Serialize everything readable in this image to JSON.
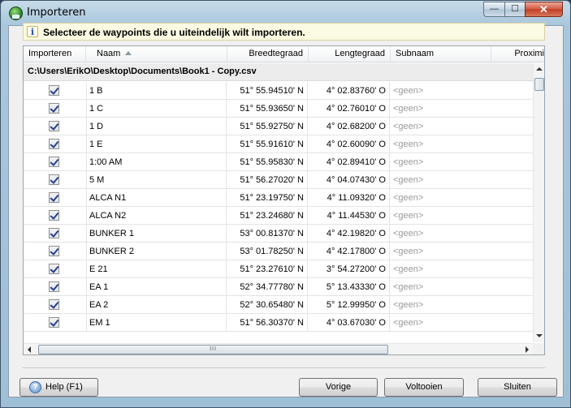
{
  "window": {
    "title": "Importeren",
    "min_glyph": "—",
    "max_glyph": "☐",
    "close_glyph": "✕"
  },
  "info": {
    "icon": "i",
    "text": "Selecteer de waypoints die u uiteindelijk wilt importeren."
  },
  "table": {
    "columns": [
      "Importeren",
      "Naam",
      "Breedtegraad",
      "Lengtegraad",
      "Subnaam",
      "Proximi"
    ],
    "sort_column": "Naam",
    "group_label": "C:\\Users\\ErikO\\Desktop\\Documents\\Book1 - Copy.csv",
    "rows": [
      {
        "checked": true,
        "name": "1 B",
        "lat": "51° 55.94510' N",
        "lon": "4° 02.83760' O",
        "sub": "<geen>"
      },
      {
        "checked": true,
        "name": "1 C",
        "lat": "51° 55.93650' N",
        "lon": "4° 02.76010' O",
        "sub": "<geen>"
      },
      {
        "checked": true,
        "name": "1 D",
        "lat": "51° 55.92750' N",
        "lon": "4° 02.68200' O",
        "sub": "<geen>"
      },
      {
        "checked": true,
        "name": "1 E",
        "lat": "51° 55.91610' N",
        "lon": "4° 02.60090' O",
        "sub": "<geen>"
      },
      {
        "checked": true,
        "name": "1:00 AM",
        "lat": "51° 55.95830' N",
        "lon": "4° 02.89410' O",
        "sub": "<geen>"
      },
      {
        "checked": true,
        "name": "5 M",
        "lat": "51° 56.27020' N",
        "lon": "4° 04.07430' O",
        "sub": "<geen>"
      },
      {
        "checked": true,
        "name": "ALCA N1",
        "lat": "51° 23.19750' N",
        "lon": "4° 11.09320' O",
        "sub": "<geen>"
      },
      {
        "checked": true,
        "name": "ALCA N2",
        "lat": "51° 23.24680' N",
        "lon": "4° 11.44530' O",
        "sub": "<geen>"
      },
      {
        "checked": true,
        "name": "BUNKER 1",
        "lat": "53° 00.81370' N",
        "lon": "4° 42.19820' O",
        "sub": "<geen>"
      },
      {
        "checked": true,
        "name": "BUNKER 2",
        "lat": "53° 01.78250' N",
        "lon": "4° 42.17800' O",
        "sub": "<geen>"
      },
      {
        "checked": true,
        "name": "E 21",
        "lat": "51° 23.27610' N",
        "lon": "3° 54.27200' O",
        "sub": "<geen>"
      },
      {
        "checked": true,
        "name": "EA 1",
        "lat": "52° 34.77780' N",
        "lon": "5° 13.43330' O",
        "sub": "<geen>"
      },
      {
        "checked": true,
        "name": "EA 2",
        "lat": "52° 30.65480' N",
        "lon": "5° 12.99950' O",
        "sub": "<geen>"
      },
      {
        "checked": true,
        "name": "EM 1",
        "lat": "51° 56.30370' N",
        "lon": "4° 03.67030' O",
        "sub": "<geen>"
      }
    ],
    "hscroll_grip": "III"
  },
  "buttons": {
    "help": "Help (F1)",
    "help_icon": "?",
    "prev": "Vorige",
    "finish": "Voltooien",
    "close": "Sluiten"
  }
}
